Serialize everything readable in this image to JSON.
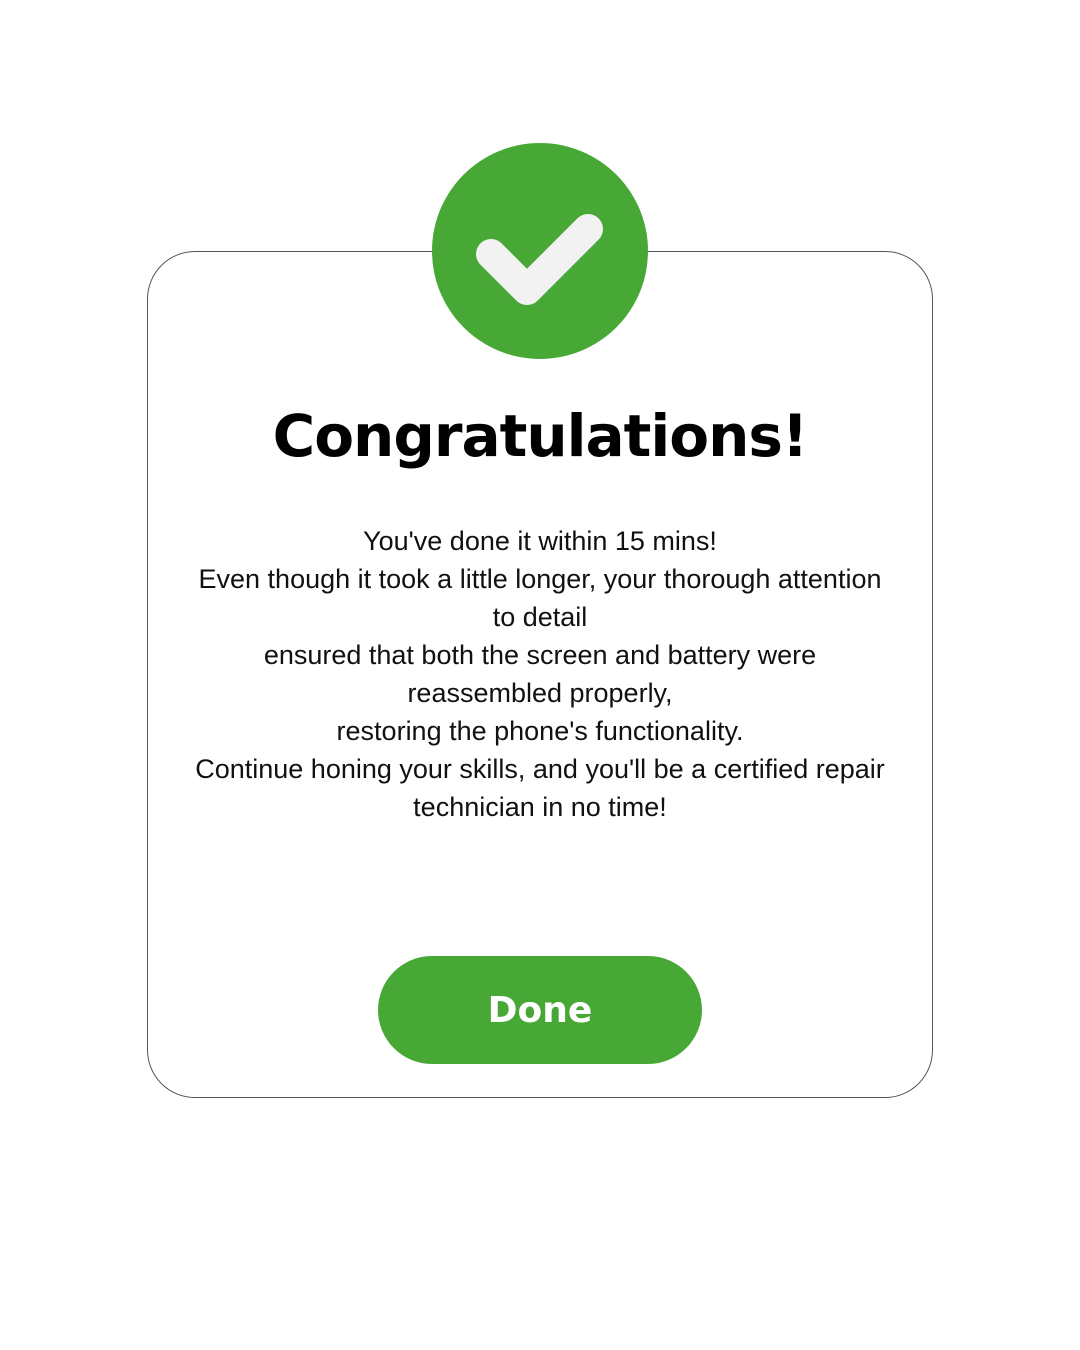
{
  "dialog": {
    "icon": "check-icon",
    "title": "Congratulations!",
    "message_lines": [
      "You've done it within 15 mins!",
      "Even though it took a little longer, your thorough attention to detail",
      "ensured that both the screen and battery were reassembled properly,",
      "restoring the phone's functionality.",
      "Continue honing your skills, and you'll be a certified repair technician in no time!"
    ],
    "done_label": "Done"
  },
  "colors": {
    "accent": "#47a836",
    "check": "#f2f2f2",
    "border": "#555555",
    "background": "#ffffff"
  }
}
